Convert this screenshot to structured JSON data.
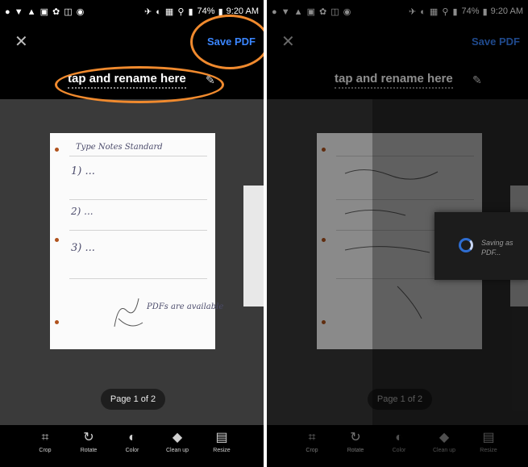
{
  "status": {
    "time": "9:20 AM",
    "battery": "74%"
  },
  "left": {
    "save_label": "Save PDF",
    "filename": "tap and rename here",
    "page_indicator": "Page 1 of 2",
    "notes": [
      "Type Notes Standard",
      "1) ...",
      "2) ...",
      "3) ...",
      "PDFs are available"
    ],
    "tools": [
      {
        "icon": "crop-icon",
        "label": "Crop"
      },
      {
        "icon": "rotate-icon",
        "label": "Rotate"
      },
      {
        "icon": "color-icon",
        "label": "Color"
      },
      {
        "icon": "cleanup-icon",
        "label": "Clean up"
      },
      {
        "icon": "resize-icon",
        "label": "Resize"
      }
    ]
  },
  "right": {
    "save_label": "Save PDF",
    "filename": "tap and rename here",
    "page_indicator": "Page 1 of 2",
    "saving_text": "Saving as PDF...",
    "tools": [
      {
        "icon": "crop-icon",
        "label": "Crop"
      },
      {
        "icon": "rotate-icon",
        "label": "Rotate"
      },
      {
        "icon": "color-icon",
        "label": "Color"
      },
      {
        "icon": "cleanup-icon",
        "label": "Clean up"
      },
      {
        "icon": "resize-icon",
        "label": "Resize"
      }
    ]
  },
  "colors": {
    "accent": "#3a86ff",
    "highlight": "#f08a2e"
  }
}
